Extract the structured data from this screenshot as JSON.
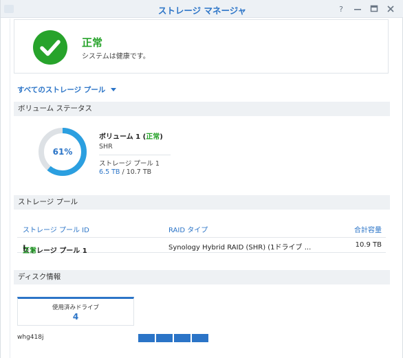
{
  "window": {
    "title": "ストレージ マネージャ",
    "controls": [
      "help-icon",
      "minimize-icon",
      "maximize-icon",
      "close-icon"
    ]
  },
  "status": {
    "title": "正常",
    "description": "システムは健康です。",
    "icon": "check-circle-icon",
    "color": "#27a32b"
  },
  "pool_selector": {
    "label": "すべてのストレージ プール",
    "icon": "caret-down-icon"
  },
  "volume_section": {
    "header": "ボリューム ステータス",
    "usage_percent": 61,
    "usage_label": "61%",
    "volume_name": "ボリューム 1",
    "volume_status_open": "(",
    "volume_status": "正常",
    "volume_status_close": ")",
    "raid_type": "SHR",
    "pool_name": "ストレージ プール 1",
    "used": "6.5 TB",
    "separator": " / ",
    "total": "10.7 TB",
    "accent_color": "#2b9fe0"
  },
  "pool_section": {
    "header": "ストレージ プール",
    "columns": [
      "ストレージ プール ID",
      "RAID タイプ",
      "合計容量"
    ],
    "rows": [
      {
        "name": "ストレージ プール 1",
        "status_open": "(",
        "status": "正常",
        "status_close": ")",
        "raid": "Synology Hybrid RAID (SHR) (1ドライブ ...",
        "capacity": "10.9 TB"
      }
    ]
  },
  "disk_section": {
    "header": "ディスク情報",
    "card_label": "使用済みドライブ",
    "card_value": "4",
    "host": "whg418j",
    "slot_count": 4,
    "slot_color": "#2b74c7"
  }
}
